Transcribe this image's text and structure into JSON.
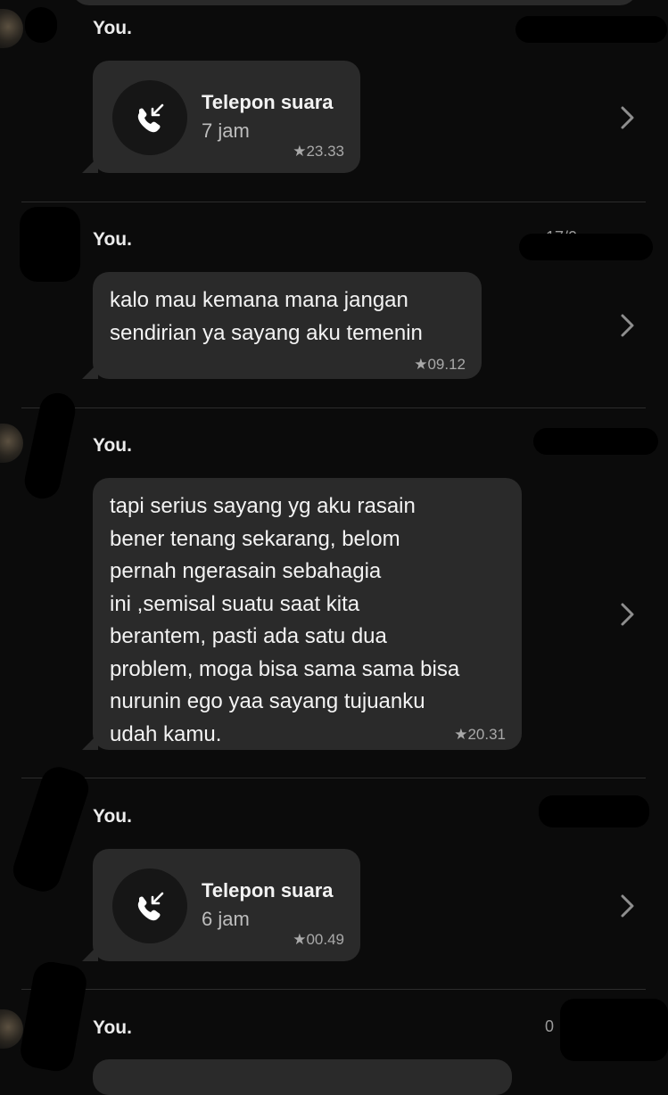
{
  "sender_label": "You.",
  "messages": [
    {
      "kind": "call",
      "title": "Telepon suara",
      "duration": "7 jam",
      "time": "★23.33",
      "date": ""
    },
    {
      "kind": "text",
      "text": "kalo mau kemana mana jangan\nsendirian ya sayang aku temenin",
      "time": "★09.12",
      "date": "17/0"
    },
    {
      "kind": "text",
      "text": "tapi serius sayang yg aku rasain\nbener tenang sekarang, belom\npernah ngerasain sebahagia\nini ,semisal suatu saat kita\nberantem, pasti ada satu dua\nproblem, moga bisa sama sama bisa\nnurunin ego yaa sayang tujuanku\nudah kamu.",
      "time": "★20.31",
      "date": ""
    },
    {
      "kind": "call",
      "title": "Telepon suara",
      "duration": "6 jam",
      "time": "★00.49",
      "date": ""
    },
    {
      "kind": "text",
      "text": "",
      "time": "",
      "date": "0"
    }
  ],
  "icons": {
    "call": "incoming-call-icon",
    "chevron": "chevron-right-icon"
  },
  "colors": {
    "background": "#0b0b0b",
    "bubble": "#2a2a2a",
    "call_circle": "#161616",
    "muted": "#a9a9a9"
  }
}
